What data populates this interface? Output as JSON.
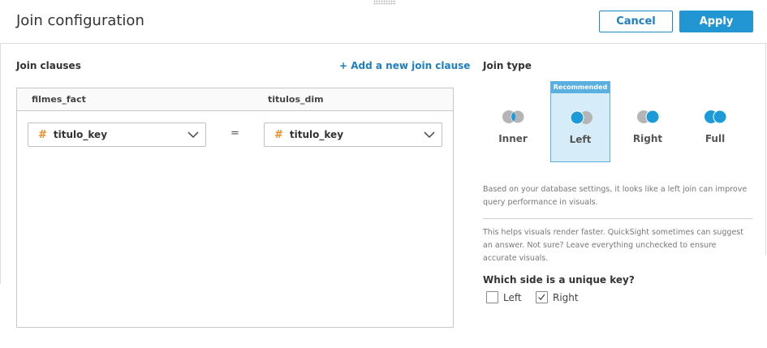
{
  "header": {
    "title": "Join configuration",
    "cancel_label": "Cancel",
    "apply_label": "Apply"
  },
  "join_clauses": {
    "title": "Join clauses",
    "add_label": "+ Add a new join clause",
    "left_table": "filmes_fact",
    "right_table": "titulos_dim",
    "clauses": [
      {
        "left_field": "titulo_key",
        "operator": "=",
        "right_field": "titulo_key",
        "left_icon": "hash-icon",
        "right_icon": "hash-icon"
      }
    ]
  },
  "join_type": {
    "title": "Join type",
    "options": [
      {
        "label": "Inner",
        "selected": false,
        "badge": ""
      },
      {
        "label": "Left",
        "selected": true,
        "badge": "Recommended"
      },
      {
        "label": "Right",
        "selected": false,
        "badge": ""
      },
      {
        "label": "Full",
        "selected": false,
        "badge": ""
      }
    ],
    "recommendation_note": "Based on your database settings, it looks like a left join can improve query performance in visuals.",
    "unique_key_note": "This helps visuals render faster. QuickSight sometimes can suggest an answer. Not sure? Leave everything unchecked to ensure accurate visuals.",
    "unique_key_question": "Which side is a unique key?",
    "unique_key_options": [
      {
        "label": "Left",
        "checked": false
      },
      {
        "label": "Right",
        "checked": true
      }
    ]
  },
  "colors": {
    "accent": "#2296d3",
    "venn_active": "#1d9ad8",
    "venn_inactive": "#b5b5b5",
    "selected_bg": "#d6ecf8",
    "field_icon": "#e8902a"
  }
}
